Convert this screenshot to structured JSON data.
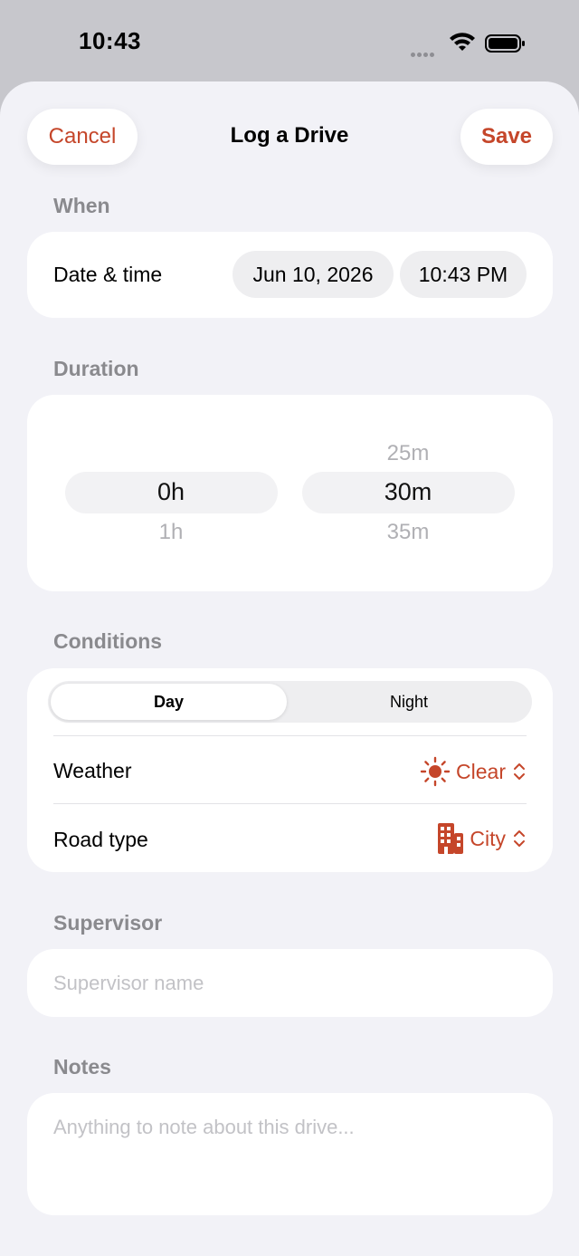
{
  "status": {
    "time": "10:43"
  },
  "nav": {
    "cancel": "Cancel",
    "title": "Log a Drive",
    "save": "Save"
  },
  "when": {
    "section": "When",
    "label": "Date & time",
    "date": "Jun 10, 2026",
    "time": "10:43 PM"
  },
  "duration": {
    "section": "Duration",
    "hours": {
      "selected": "0h",
      "below": "1h"
    },
    "minutes": {
      "above": "25m",
      "selected": "30m",
      "below": "35m"
    }
  },
  "conditions": {
    "section": "Conditions",
    "segments": [
      "Day",
      "Night"
    ],
    "selected_segment": "Day",
    "weather_label": "Weather",
    "weather_value": "Clear",
    "weather_icon": "sun-icon",
    "road_label": "Road type",
    "road_value": "City",
    "road_icon": "building-icon"
  },
  "supervisor": {
    "section": "Supervisor",
    "placeholder": "Supervisor name"
  },
  "notes": {
    "section": "Notes",
    "placeholder": "Anything to note about this drive..."
  },
  "colors": {
    "accent": "#c5462a",
    "background": "#f2f2f7",
    "label_gray": "#8a8a8e"
  }
}
